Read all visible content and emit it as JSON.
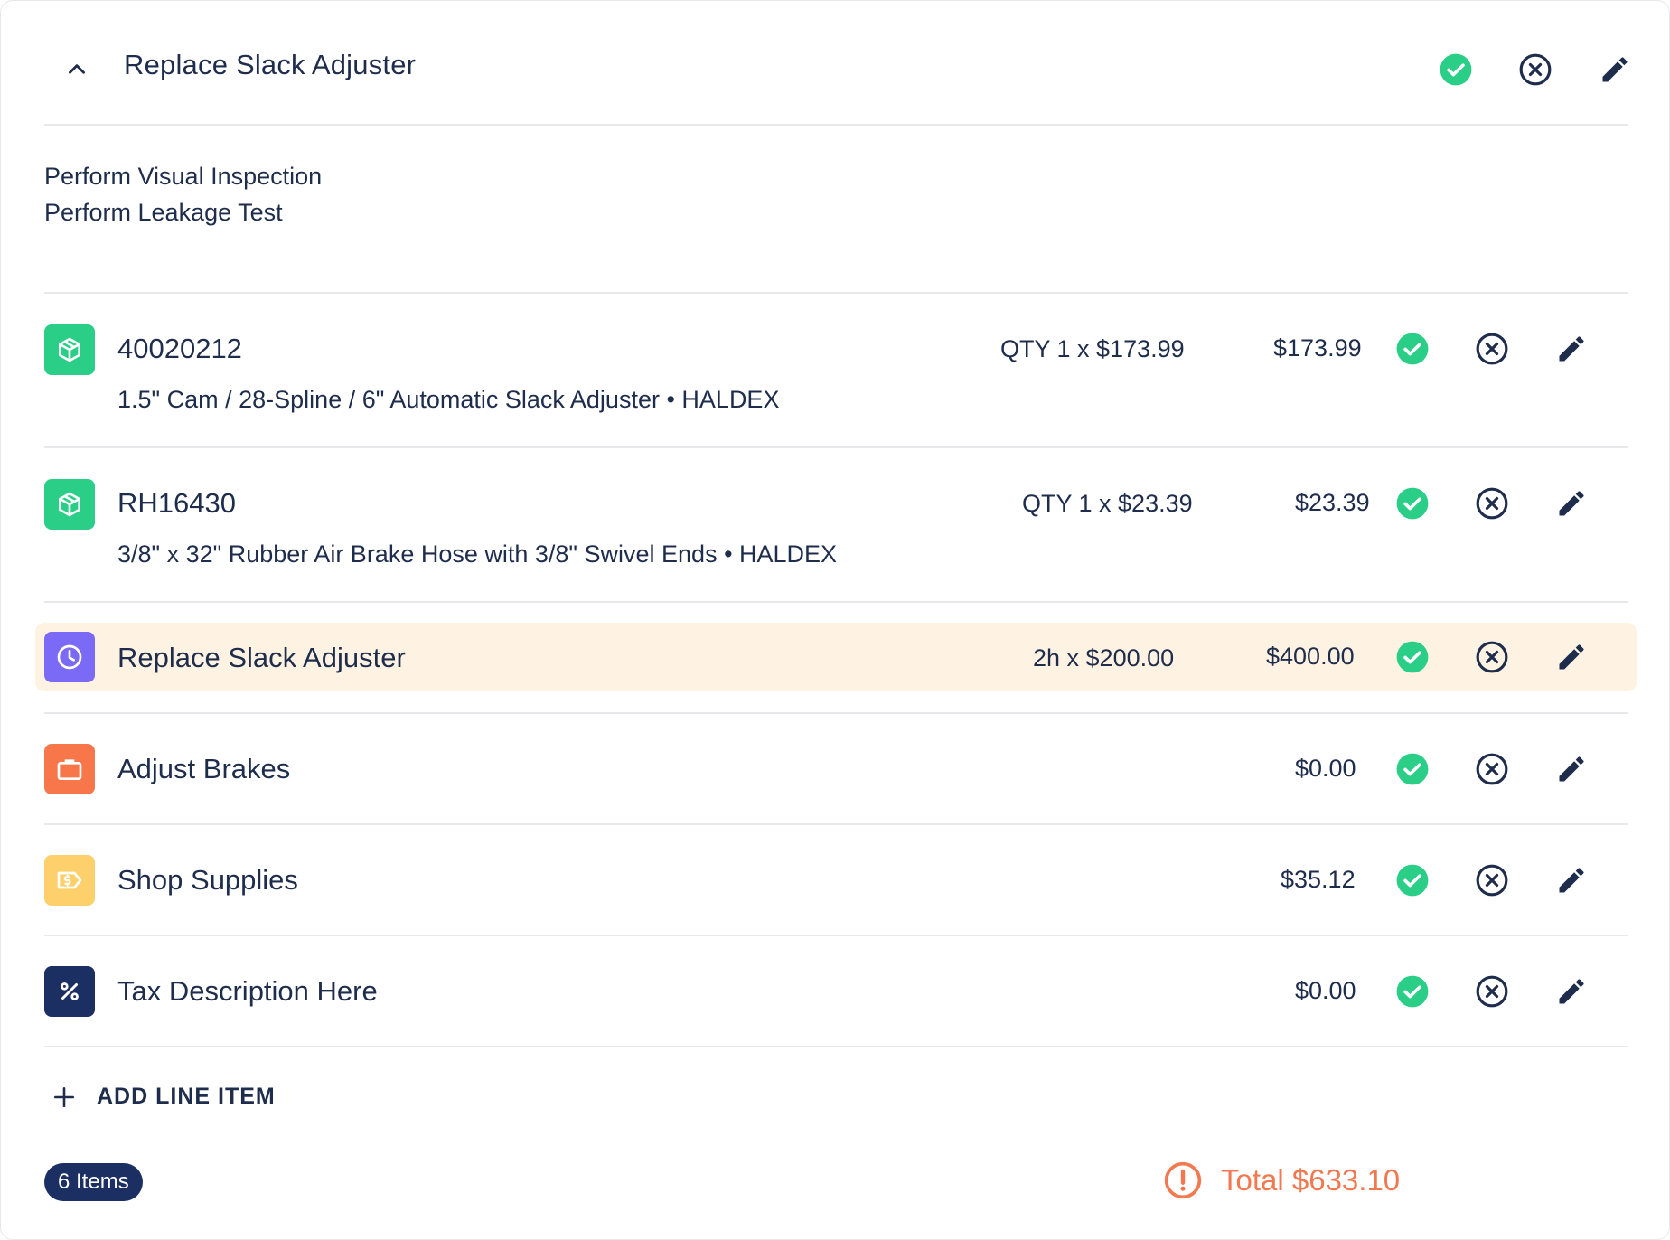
{
  "job": {
    "title": "Replace Slack Adjuster",
    "description": [
      "Perform Visual Inspection",
      "Perform Leakage Test"
    ]
  },
  "line_items": [
    {
      "type": "part",
      "icon": "package-icon",
      "title": "40020212",
      "subtitle": "1.5\" Cam / 28-Spline / 6\" Automatic Slack Adjuster  •  HALDEX",
      "qty": "QTY 1 x $173.99",
      "price": "$173.99"
    },
    {
      "type": "part",
      "icon": "package-icon",
      "title": "RH16430",
      "subtitle": "3/8\" x 32\" Rubber Air Brake Hose with 3/8\" Swivel Ends  •  HALDEX",
      "qty": "QTY 1 x $23.39",
      "price": "$23.39"
    },
    {
      "type": "labor",
      "icon": "clock-icon",
      "title": "Replace Slack Adjuster",
      "qty": "2h x $200.00",
      "price": "$400.00",
      "highlighted": true
    },
    {
      "type": "service",
      "icon": "briefcase-icon",
      "title": "Adjust Brakes",
      "price": "$0.00"
    },
    {
      "type": "supplies",
      "icon": "price-tag-icon",
      "title": "Shop Supplies",
      "price": "$35.12"
    },
    {
      "type": "tax",
      "icon": "percent-icon",
      "title": "Tax Description Here",
      "price": "$0.00"
    }
  ],
  "add_line_item_label": "ADD LINE ITEM",
  "items_count_label": "6 Items",
  "total_label": "Total $633.10",
  "colors": {
    "text": "#1f2d4d",
    "approve": "#2bce86",
    "part": "#2bce86",
    "labor": "#7b6af5",
    "service": "#f8774a",
    "supplies": "#fdd06b",
    "tax": "#1c2f63",
    "highlight": "#fef3e2",
    "warning": "#f2784f"
  }
}
